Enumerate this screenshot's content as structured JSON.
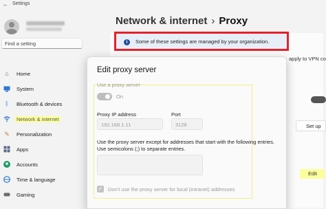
{
  "window": {
    "title": "Settings"
  },
  "sidebar": {
    "find_placeholder": "Find a setting",
    "items": [
      {
        "label": "Home",
        "icon": "home-icon"
      },
      {
        "label": "System",
        "icon": "monitor-icon"
      },
      {
        "label": "Bluetooth & devices",
        "icon": "bluetooth-icon"
      },
      {
        "label": "Network & internet",
        "icon": "wifi-icon"
      },
      {
        "label": "Personalization",
        "icon": "brush-icon"
      },
      {
        "label": "Apps",
        "icon": "apps-icon"
      },
      {
        "label": "Accounts",
        "icon": "person-icon"
      },
      {
        "label": "Time & language",
        "icon": "globe-icon"
      },
      {
        "label": "Gaming",
        "icon": "gamepad-icon"
      }
    ]
  },
  "header": {
    "section": "Network & internet",
    "separator": "›",
    "page": "Proxy"
  },
  "banner": {
    "message": "Some of these settings are managed by your organization."
  },
  "right_panel": {
    "partial_text": "apply to VPN co",
    "setup_label": "Set up",
    "edit_label": "Edit"
  },
  "dialog": {
    "title": "Edit proxy server",
    "use_proxy_label": "Use a proxy server",
    "toggle_state": "On",
    "ip_label": "Proxy IP address",
    "ip_value": "192.168.1.11",
    "port_label": "Port",
    "port_value": "3128",
    "exceptions_text": "Use the proxy server except for addresses that start with the following entries. Use semicolons (;) to separate entries.",
    "exceptions_value": "",
    "local_checkbox_label": "Don't use the proxy server for local (intranet) addresses",
    "local_checkbox_checked": true
  },
  "colors": {
    "banner_border": "#e5202a",
    "banner_bg": "#e8eef8",
    "info_icon": "#1f4e9c",
    "highlight": "#fbff9c"
  }
}
